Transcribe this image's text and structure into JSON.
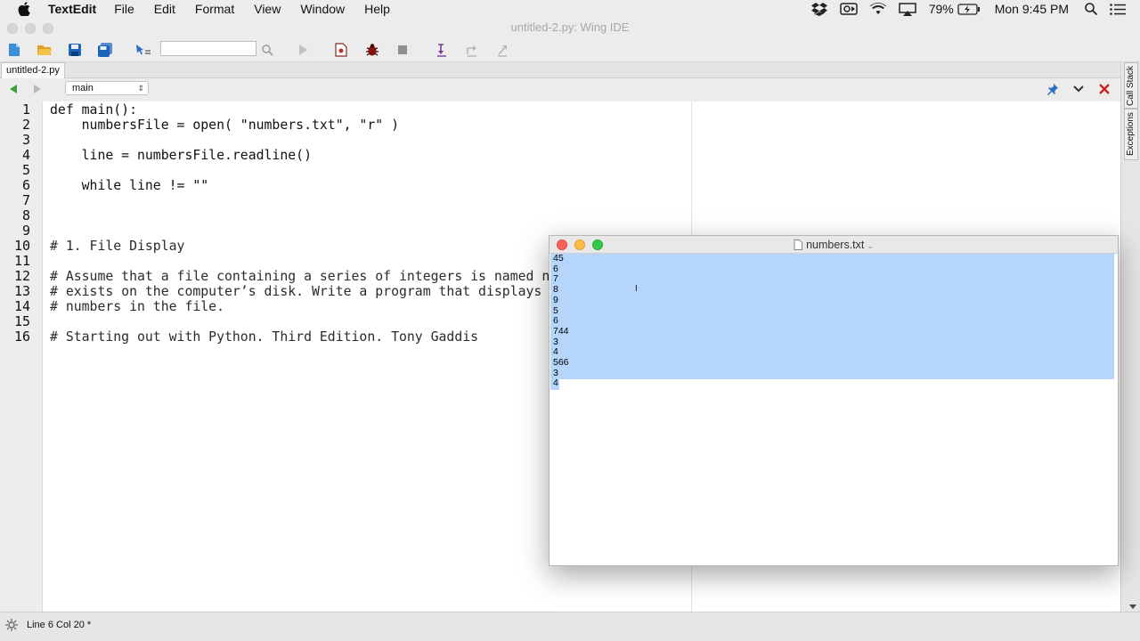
{
  "menubar": {
    "app_name": "TextEdit",
    "menus": [
      "File",
      "Edit",
      "Format",
      "View",
      "Window",
      "Help"
    ],
    "battery": "79%",
    "clock": "Mon 9:45 PM"
  },
  "window": {
    "title": "untitled-2.py: Wing IDE"
  },
  "toolbar": {
    "search_placeholder": ""
  },
  "editor": {
    "tab_label": "untitled-2.py",
    "function_selector": "main",
    "lines": [
      {
        "n": "1",
        "text": "def main():"
      },
      {
        "n": "2",
        "text": "    numbersFile = open( \"numbers.txt\", \"r\" )"
      },
      {
        "n": "3",
        "text": ""
      },
      {
        "n": "4",
        "text": "    line = numbersFile.readline()"
      },
      {
        "n": "5",
        "text": ""
      },
      {
        "n": "6",
        "text": "    while line != \"\""
      },
      {
        "n": "7",
        "text": ""
      },
      {
        "n": "8",
        "text": ""
      },
      {
        "n": "9",
        "text": ""
      },
      {
        "n": "10",
        "text": "# 1. File Display"
      },
      {
        "n": "11",
        "text": ""
      },
      {
        "n": "12",
        "text": "# Assume that a file containing a series of integers is named n"
      },
      {
        "n": "13",
        "text": "# exists on the computer’s disk. Write a program that displays"
      },
      {
        "n": "14",
        "text": "# numbers in the file."
      },
      {
        "n": "15",
        "text": ""
      },
      {
        "n": "16",
        "text": "# Starting out with Python. Third Edition. Tony Gaddis"
      }
    ]
  },
  "side_tabs": {
    "call_stack": "Call Stack",
    "exceptions": "Exceptions"
  },
  "status": {
    "text": "Line 6 Col 20 *"
  },
  "textedit": {
    "title": "numbers.txt",
    "lines": [
      "45",
      "6",
      "7",
      "8",
      "9",
      "5",
      "6",
      "744",
      "3",
      "4",
      "566",
      "3",
      "4"
    ]
  }
}
